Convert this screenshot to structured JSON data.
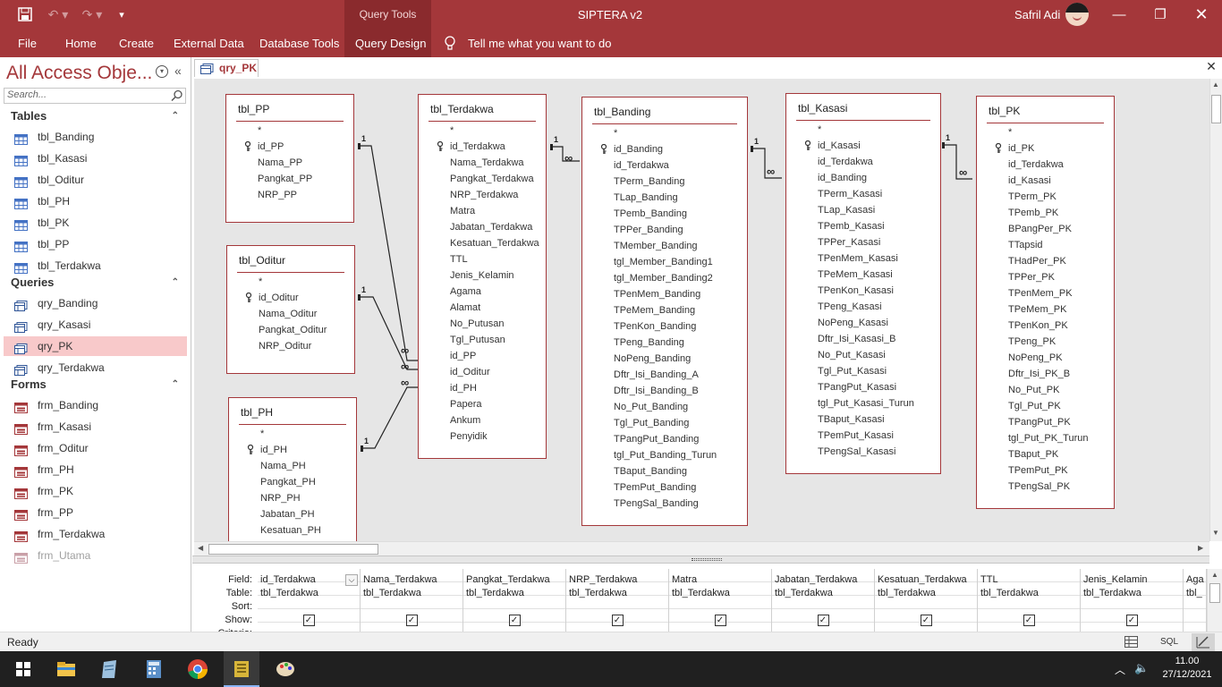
{
  "window": {
    "context_tab": "Query Tools",
    "title": "SIPTERA v2",
    "user": "Safril Adi"
  },
  "ribbon_tabs": [
    "File",
    "Home",
    "Create",
    "External Data",
    "Database Tools",
    "Query Design"
  ],
  "tell_me": "Tell me what you want to do",
  "nav": {
    "title": "All Access Obje...",
    "search_placeholder": "Search...",
    "groups": [
      {
        "label": "Tables",
        "items": [
          "tbl_Banding",
          "tbl_Kasasi",
          "tbl_Oditur",
          "tbl_PH",
          "tbl_PK",
          "tbl_PP",
          "tbl_Terdakwa"
        ]
      },
      {
        "label": "Queries",
        "items": [
          "qry_Banding",
          "qry_Kasasi",
          "qry_PK",
          "qry_Terdakwa"
        ]
      },
      {
        "label": "Forms",
        "items": [
          "frm_Banding",
          "frm_Kasasi",
          "frm_Oditur",
          "frm_PH",
          "frm_PK",
          "frm_PP",
          "frm_Terdakwa",
          "frm_Utama"
        ]
      }
    ]
  },
  "doc_tab": "qry_PK",
  "tables": [
    {
      "name": "tbl_PP",
      "fields": [
        "*",
        "id_PP",
        "Nama_PP",
        "Pangkat_PP",
        "NRP_PP"
      ],
      "key": "id_PP"
    },
    {
      "name": "tbl_Oditur",
      "fields": [
        "*",
        "id_Oditur",
        "Nama_Oditur",
        "Pangkat_Oditur",
        "NRP_Oditur"
      ],
      "key": "id_Oditur"
    },
    {
      "name": "tbl_PH",
      "fields": [
        "*",
        "id_PH",
        "Nama_PH",
        "Pangkat_PH",
        "NRP_PH",
        "Jabatan_PH",
        "Kesatuan_PH"
      ],
      "key": "id_PH"
    },
    {
      "name": "tbl_Terdakwa",
      "fields": [
        "*",
        "id_Terdakwa",
        "Nama_Terdakwa",
        "Pangkat_Terdakwa",
        "NRP_Terdakwa",
        "Matra",
        "Jabatan_Terdakwa",
        "Kesatuan_Terdakwa",
        "TTL",
        "Jenis_Kelamin",
        "Agama",
        "Alamat",
        "No_Putusan",
        "Tgl_Putusan",
        "id_PP",
        "id_Oditur",
        "id_PH",
        "Papera",
        "Ankum",
        "Penyidik"
      ],
      "key": "id_Terdakwa"
    },
    {
      "name": "tbl_Banding",
      "fields": [
        "*",
        "id_Banding",
        "id_Terdakwa",
        "TPerm_Banding",
        "TLap_Banding",
        "TPemb_Banding",
        "TPPer_Banding",
        "TMember_Banding",
        "tgl_Member_Banding1",
        "tgl_Member_Banding2",
        "TPenMem_Banding",
        "TPeMem_Banding",
        "TPenKon_Banding",
        "TPeng_Banding",
        "NoPeng_Banding",
        "Dftr_Isi_Banding_A",
        "Dftr_Isi_Banding_B",
        "No_Put_Banding",
        "Tgl_Put_Banding",
        "TPangPut_Banding",
        "tgl_Put_Banding_Turun",
        "TBaput_Banding",
        "TPemPut_Banding",
        "TPengSal_Banding"
      ],
      "key": "id_Banding"
    },
    {
      "name": "tbl_Kasasi",
      "fields": [
        "*",
        "id_Kasasi",
        "id_Terdakwa",
        "id_Banding",
        "TPerm_Kasasi",
        "TLap_Kasasi",
        "TPemb_Kasasi",
        "TPPer_Kasasi",
        "TPenMem_Kasasi",
        "TPeMem_Kasasi",
        "TPenKon_Kasasi",
        "TPeng_Kasasi",
        "NoPeng_Kasasi",
        "Dftr_Isi_Kasasi_B",
        "No_Put_Kasasi",
        "Tgl_Put_Kasasi",
        "TPangPut_Kasasi",
        "tgl_Put_Kasasi_Turun",
        "TBaput_Kasasi",
        "TPemPut_Kasasi",
        "TPengSal_Kasasi"
      ],
      "key": "id_Kasasi"
    },
    {
      "name": "tbl_PK",
      "fields": [
        "*",
        "id_PK",
        "id_Terdakwa",
        "id_Kasasi",
        "TPerm_PK",
        "TPemb_PK",
        "BPangPer_PK",
        "TTapsid",
        "THadPer_PK",
        "TPPer_PK",
        "TPenMem_PK",
        "TPeMem_PK",
        "TPenKon_PK",
        "TPeng_PK",
        "NoPeng_PK",
        "Dftr_Isi_PK_B",
        "No_Put_PK",
        "Tgl_Put_PK",
        "TPangPut_PK",
        "tgl_Put_PK_Turun",
        "TBaput_PK",
        "TPemPut_PK",
        "TPengSal_PK"
      ],
      "key": "id_PK"
    }
  ],
  "rel_labels": {
    "one": "1",
    "many": "∞"
  },
  "grid": {
    "row_labels": [
      "Field:",
      "Table:",
      "Sort:",
      "Show:",
      "Criteria:"
    ],
    "columns": [
      {
        "field": "id_Terdakwa",
        "table": "tbl_Terdakwa",
        "show": true
      },
      {
        "field": "Nama_Terdakwa",
        "table": "tbl_Terdakwa",
        "show": true
      },
      {
        "field": "Pangkat_Terdakwa",
        "table": "tbl_Terdakwa",
        "show": true
      },
      {
        "field": "NRP_Terdakwa",
        "table": "tbl_Terdakwa",
        "show": true
      },
      {
        "field": "Matra",
        "table": "tbl_Terdakwa",
        "show": true
      },
      {
        "field": "Jabatan_Terdakwa",
        "table": "tbl_Terdakwa",
        "show": true
      },
      {
        "field": "Kesatuan_Terdakwa",
        "table": "tbl_Terdakwa",
        "show": true
      },
      {
        "field": "TTL",
        "table": "tbl_Terdakwa",
        "show": true
      },
      {
        "field": "Jenis_Kelamin",
        "table": "tbl_Terdakwa",
        "show": true
      },
      {
        "field": "Aga",
        "table": "tbl_",
        "show": false
      }
    ]
  },
  "status": {
    "text": "Ready",
    "sql": "SQL"
  },
  "clock": {
    "time": "11.00",
    "date": "27/12/2021"
  },
  "colors": {
    "accent": "#a4373a",
    "selected": "#f8c9ca"
  }
}
